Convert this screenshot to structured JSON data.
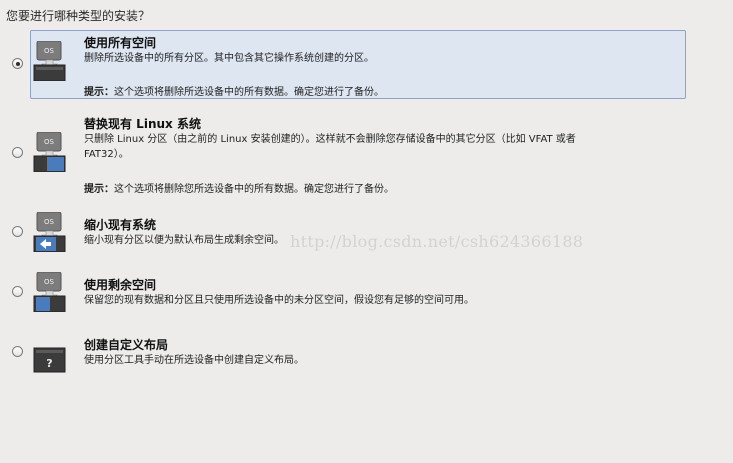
{
  "question": "您要进行哪种类型的安装？",
  "options": [
    {
      "title": "使用所有空间",
      "desc": "删除所选设备中的所有分区。其中包含其它操作系统创建的分区。",
      "hint_label": "提示：",
      "hint_text": "这个选项将删除所选设备中的所有数据。确定您进行了备份。",
      "selected": true
    },
    {
      "title": "替换现有 Linux 系统",
      "desc_line1": "只删除 Linux 分区（由之前的 Linux 安装创建的）。这样就不会删除您存储设备中的其它分区（比如 VFAT 或者",
      "desc_line2": "FAT32）。",
      "hint_label": "提示：",
      "hint_text": "这个选项将删除您所选设备中的所有数据。确定您进行了备份。",
      "selected": false
    },
    {
      "title": "缩小现有系统",
      "desc": "缩小现有分区以便为默认布局生成剩余空间。",
      "selected": false
    },
    {
      "title": "使用剩余空间",
      "desc": "保留您的现有数据和分区且只使用所选设备中的未分区空间，假设您有足够的空间可用。",
      "selected": false
    },
    {
      "title": "创建自定义布局",
      "desc": "使用分区工具手动在所选设备中创建自定义布局。",
      "selected": false
    }
  ],
  "icon_labels": {
    "os": "OS",
    "custom": "?"
  },
  "watermark": "http://blog.csdn.net/csh624366188",
  "colors": {
    "selected_bg": "#dee6f2",
    "selected_border": "#8ea3c8",
    "drive": "#3a3a3a",
    "drive_blue": "#4a7bbd"
  }
}
